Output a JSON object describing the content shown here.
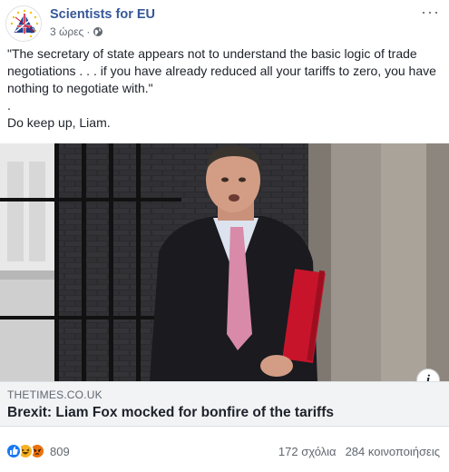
{
  "header": {
    "page_name": "Scientists for EU",
    "time": "3 ώρες",
    "separator": "·",
    "avatar_icon": "eu-uk-flag-logo-icon",
    "privacy_icon": "globe-icon",
    "more_icon": "more-options-icon",
    "more_label": "···"
  },
  "post": {
    "text_line1": "\"The secretary of state appears not to understand the basic logic of trade negotiations . . . if you have already reduced all your tariffs to zero, you have nothing to negotiate with.\"",
    "text_line2": ".",
    "text_line3": "Do keep up, Liam."
  },
  "link": {
    "image_icon": "link-preview-photo",
    "info_label": "i",
    "domain": "THETIMES.CO.UK",
    "title": "Brexit: Liam Fox mocked for bonfire of the tariffs"
  },
  "footer": {
    "reaction_icons": [
      "like-icon",
      "haha-icon",
      "angry-icon"
    ],
    "reaction_count": "809",
    "comments": "172 σχόλια",
    "shares": "284 κοινοποιήσεις"
  },
  "colors": {
    "page_name": "#365899",
    "caption_bg": "#f2f3f5",
    "like_blue": "#1877f2"
  }
}
